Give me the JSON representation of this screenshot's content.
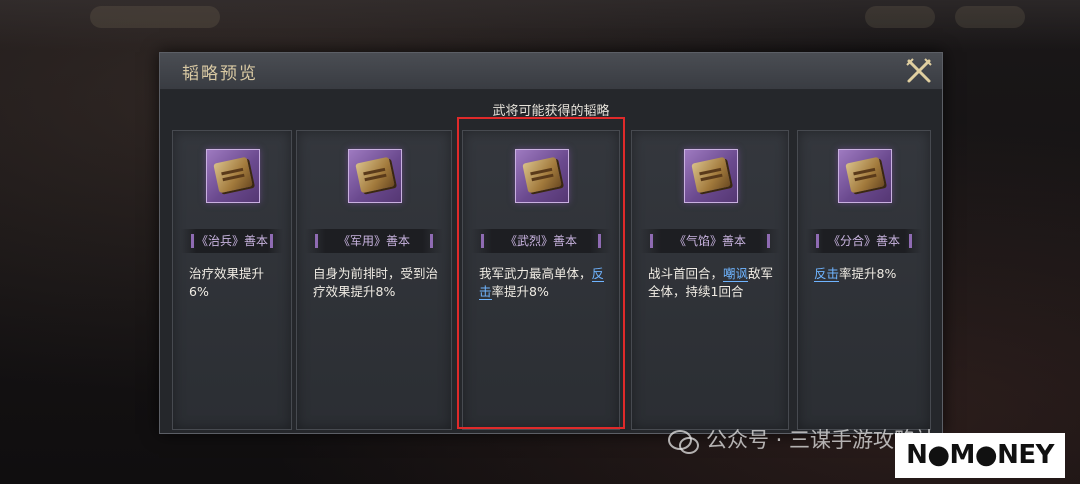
{
  "dialog": {
    "title": "韬略预览",
    "section_title": "武将可能获得的韬略"
  },
  "cards": [
    {
      "name": "《治兵》善本",
      "desc_pre": "治疗效果提升6%",
      "keyword": "",
      "desc_post": "",
      "icon": "book-bundle-icon"
    },
    {
      "name": "《军用》善本",
      "desc_pre": "自身为前排时，受到治疗效果提升8%",
      "keyword": "",
      "desc_post": "",
      "icon": "scroll-icon"
    },
    {
      "name": "《武烈》善本",
      "desc_pre": "我军武力最高单体，",
      "keyword": "反击",
      "desc_post": "率提升8%",
      "icon": "stacked-books-icon"
    },
    {
      "name": "《气馅》善本",
      "desc_pre": "战斗首回合，",
      "keyword": "嘲讽",
      "desc_post": "敌军全体，持续1回合",
      "icon": "open-scroll-icon"
    },
    {
      "name": "《分合》善本",
      "desc_pre": "",
      "keyword": "反击",
      "desc_post": "率提升8%",
      "icon": "rolled-scroll-icon"
    }
  ],
  "watermark": {
    "text": "公众号 · 三谋手游攻略站"
  },
  "logo": {
    "text": "N●M●NEY"
  },
  "colors": {
    "highlight_border": "#e02a2a",
    "keyword": "#6fb4ff",
    "card_name": "#c9b4e0"
  }
}
